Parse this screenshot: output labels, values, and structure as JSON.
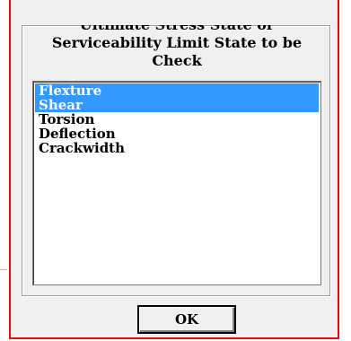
{
  "dialog": {
    "group_title_line1": "Ultimate Stress State or",
    "group_title_line2": "Serviceability Limit State to be",
    "group_title_line3": "Check",
    "accent_border_color": "#e01010",
    "selection_color": "#3399ff"
  },
  "listbox": {
    "items": [
      {
        "label": "Flexture",
        "selected": true
      },
      {
        "label": "Shear",
        "selected": true
      },
      {
        "label": "Torsion",
        "selected": false
      },
      {
        "label": "Deflection",
        "selected": false
      },
      {
        "label": "Crackwidth",
        "selected": false
      }
    ]
  },
  "buttons": {
    "ok_label": "OK"
  }
}
